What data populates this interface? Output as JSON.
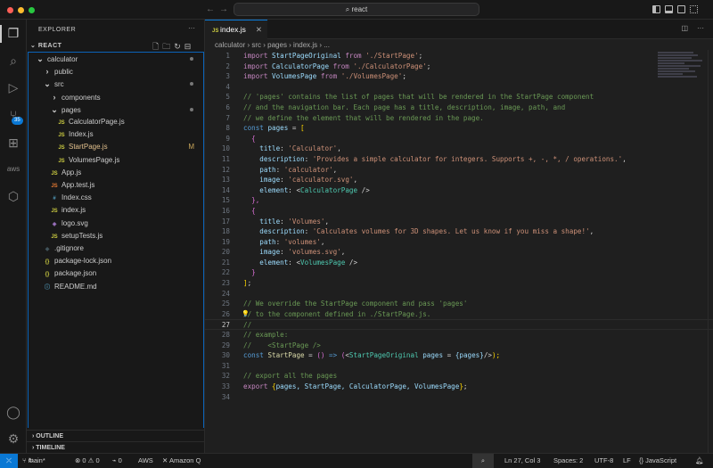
{
  "titlebar": {
    "search": "react"
  },
  "activity": {
    "scm_badge": "35"
  },
  "sidebar": {
    "title": "EXPLORER",
    "root": "REACT",
    "outline": "OUTLINE",
    "timeline": "TIMELINE",
    "items": [
      {
        "label": "calculator",
        "depth": 0,
        "type": "folder-open",
        "dot": true
      },
      {
        "label": "public",
        "depth": 1,
        "type": "folder"
      },
      {
        "label": "src",
        "depth": 1,
        "type": "folder-open",
        "dot": true
      },
      {
        "label": "components",
        "depth": 2,
        "type": "folder"
      },
      {
        "label": "pages",
        "depth": 2,
        "type": "folder-open",
        "dot": true
      },
      {
        "label": "CalculatorPage.js",
        "depth": 3,
        "type": "js"
      },
      {
        "label": "Index.js",
        "depth": 3,
        "type": "js"
      },
      {
        "label": "StartPage.js",
        "depth": 3,
        "type": "js",
        "status": "M"
      },
      {
        "label": "VolumesPage.js",
        "depth": 3,
        "type": "js"
      },
      {
        "label": "App.js",
        "depth": 2,
        "type": "js"
      },
      {
        "label": "App.test.js",
        "depth": 2,
        "type": "test"
      },
      {
        "label": "Index.css",
        "depth": 2,
        "type": "css"
      },
      {
        "label": "index.js",
        "depth": 2,
        "type": "js"
      },
      {
        "label": "logo.svg",
        "depth": 2,
        "type": "svg"
      },
      {
        "label": "setupTests.js",
        "depth": 2,
        "type": "js"
      },
      {
        "label": ".gitignore",
        "depth": 1,
        "type": "git"
      },
      {
        "label": "package-lock.json",
        "depth": 1,
        "type": "json"
      },
      {
        "label": "package.json",
        "depth": 1,
        "type": "json"
      },
      {
        "label": "README.md",
        "depth": 1,
        "type": "info"
      }
    ]
  },
  "editor": {
    "tab": "index.js",
    "breadcrumb": [
      "calculator",
      "src",
      "pages",
      "index.js",
      "..."
    ],
    "current_line": 27,
    "lines": [
      [
        [
          "import ",
          "kw"
        ],
        [
          "StartPageOriginal ",
          "var"
        ],
        [
          "from ",
          "kw"
        ],
        [
          "'./StartPage'",
          "str"
        ],
        [
          ";",
          "pl"
        ]
      ],
      [
        [
          "import ",
          "kw"
        ],
        [
          "CalculatorPage ",
          "var"
        ],
        [
          "from ",
          "kw"
        ],
        [
          "'./CalculatorPage'",
          "str"
        ],
        [
          ";",
          "pl"
        ]
      ],
      [
        [
          "import ",
          "kw"
        ],
        [
          "VolumesPage ",
          "var"
        ],
        [
          "from ",
          "kw"
        ],
        [
          "'./VolumesPage'",
          "str"
        ],
        [
          ";",
          "pl"
        ]
      ],
      [],
      [
        [
          "// 'pages' contains the list of pages that will be rendered in the StartPage component",
          "cm"
        ]
      ],
      [
        [
          "// and the navigation bar. Each page has a title, description, image, path, and",
          "cm"
        ]
      ],
      [
        [
          "// we define the element that will be rendered in the page.",
          "cm"
        ]
      ],
      [
        [
          "const ",
          "kb"
        ],
        [
          "pages ",
          "var"
        ],
        [
          "= ",
          "pl"
        ],
        [
          "[",
          "br"
        ]
      ],
      [
        [
          "  {",
          "br2"
        ]
      ],
      [
        [
          "    title",
          "var"
        ],
        [
          ": ",
          "pl"
        ],
        [
          "'Calculator'",
          "str"
        ],
        [
          ",",
          "pl"
        ]
      ],
      [
        [
          "    description",
          "var"
        ],
        [
          ": ",
          "pl"
        ],
        [
          "'Provides a simple calculator for integers. Supports +, -, *, / operations.'",
          "str"
        ],
        [
          ",",
          "pl"
        ]
      ],
      [
        [
          "    path",
          "var"
        ],
        [
          ": ",
          "pl"
        ],
        [
          "'calculator'",
          "str"
        ],
        [
          ",",
          "pl"
        ]
      ],
      [
        [
          "    image",
          "var"
        ],
        [
          ": ",
          "pl"
        ],
        [
          "'calculator.svg'",
          "str"
        ],
        [
          ",",
          "pl"
        ]
      ],
      [
        [
          "    element",
          "var"
        ],
        [
          ": ",
          "pl"
        ],
        [
          "<",
          "pl"
        ],
        [
          "CalculatorPage",
          "tag"
        ],
        [
          " />",
          "pl"
        ]
      ],
      [
        [
          "  },",
          "br2"
        ]
      ],
      [
        [
          "  {",
          "br2"
        ]
      ],
      [
        [
          "    title",
          "var"
        ],
        [
          ": ",
          "pl"
        ],
        [
          "'Volumes'",
          "str"
        ],
        [
          ",",
          "pl"
        ]
      ],
      [
        [
          "    description",
          "var"
        ],
        [
          ": ",
          "pl"
        ],
        [
          "'Calculates volumes for 3D shapes. Let us know if you miss a shape!'",
          "str"
        ],
        [
          ",",
          "pl"
        ]
      ],
      [
        [
          "    path",
          "var"
        ],
        [
          ": ",
          "pl"
        ],
        [
          "'volumes'",
          "str"
        ],
        [
          ",",
          "pl"
        ]
      ],
      [
        [
          "    image",
          "var"
        ],
        [
          ": ",
          "pl"
        ],
        [
          "'volumes.svg'",
          "str"
        ],
        [
          ",",
          "pl"
        ]
      ],
      [
        [
          "    element",
          "var"
        ],
        [
          ": ",
          "pl"
        ],
        [
          "<",
          "pl"
        ],
        [
          "VolumesPage",
          "tag"
        ],
        [
          " />",
          "pl"
        ]
      ],
      [
        [
          "  }",
          "br2"
        ]
      ],
      [
        [
          "]",
          "br"
        ],
        [
          ";",
          "pl"
        ]
      ],
      [],
      [
        [
          "// We override the StartPage component and pass 'pages'",
          "cm"
        ]
      ],
      [
        [
          "// to the component defined in ./StartPage.js.",
          "cm"
        ]
      ],
      [
        [
          "//",
          "cm"
        ]
      ],
      [
        [
          "// example:",
          "cm"
        ]
      ],
      [
        [
          "//    <StartPage />",
          "cm"
        ]
      ],
      [
        [
          "const ",
          "kb"
        ],
        [
          "StartPage ",
          "fn"
        ],
        [
          "= ",
          "pl"
        ],
        [
          "()",
          "br2"
        ],
        [
          " => ",
          "kb"
        ],
        [
          "(",
          "br2"
        ],
        [
          "<",
          "pl"
        ],
        [
          "StartPageOriginal ",
          "tag"
        ],
        [
          "pages ",
          "var"
        ],
        [
          "= ",
          "pl"
        ],
        [
          "{pages}",
          "var"
        ],
        [
          "/>",
          "pl"
        ],
        [
          ");",
          "br"
        ]
      ],
      [],
      [
        [
          "// export all the pages",
          "cm"
        ]
      ],
      [
        [
          "export ",
          "kw"
        ],
        [
          "{",
          "br"
        ],
        [
          "pages, StartPage, CalculatorPage, VolumesPage",
          "var"
        ],
        [
          "}",
          "br"
        ],
        [
          ";",
          "pl"
        ]
      ],
      []
    ]
  },
  "statusbar": {
    "branch": "main*",
    "sync": "↻",
    "errors": "0",
    "warnings": "0",
    "ports": "0",
    "aws": "AWS",
    "amazonq": "Amazon Q",
    "position": "Ln 27, Col 3",
    "spaces": "Spaces: 2",
    "encoding": "UTF-8",
    "eol": "LF",
    "language": "JavaScript"
  },
  "colors": {
    "accent": "#0a78d4",
    "background": "#1f1f1f",
    "sidebar": "#181818"
  }
}
